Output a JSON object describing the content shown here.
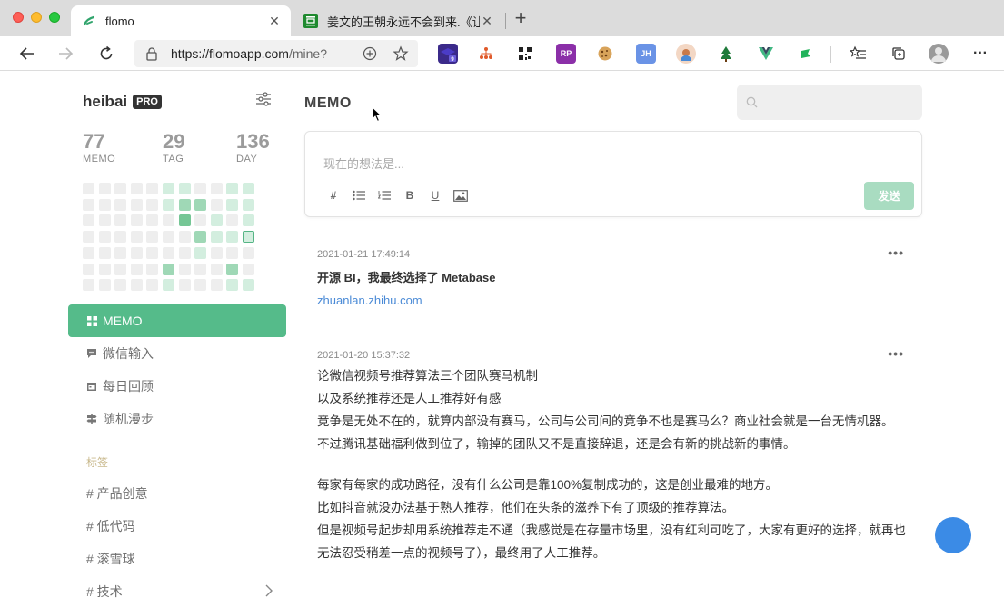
{
  "browser": {
    "tabs": [
      {
        "title": "flomo",
        "active": true,
        "icon": "flomo-icon"
      },
      {
        "title": "姜文的王朝永远不会到来.《让子",
        "active": false,
        "icon": "douban-icon"
      }
    ],
    "url_host": "https://flomoapp.com",
    "url_path": "/mine?",
    "extensions": [
      "graduation-cap-icon",
      "sitemap-icon",
      "qrcode-icon",
      "rp-icon",
      "cookie-icon",
      "jh-icon",
      "avatar-ext-icon",
      "tree-icon",
      "vue-icon",
      "flag-icon"
    ],
    "accent": "#55bb8a"
  },
  "sidebar": {
    "username": "heibai",
    "badge": "PRO",
    "stats": [
      {
        "value": "77",
        "label": "MEMO"
      },
      {
        "value": "29",
        "label": "TAG"
      },
      {
        "value": "136",
        "label": "DAY"
      }
    ],
    "heatmap": [
      [
        0,
        0,
        0,
        0,
        0,
        1,
        1,
        0,
        0,
        1,
        1
      ],
      [
        0,
        0,
        0,
        0,
        0,
        1,
        2,
        2,
        0,
        1,
        1
      ],
      [
        0,
        0,
        0,
        0,
        0,
        0,
        3,
        0,
        1,
        0,
        1
      ],
      [
        0,
        0,
        0,
        0,
        0,
        0,
        0,
        2,
        1,
        1,
        "t"
      ],
      [
        0,
        0,
        0,
        0,
        0,
        0,
        0,
        1,
        0,
        0,
        0
      ],
      [
        0,
        0,
        0,
        0,
        0,
        2,
        0,
        0,
        0,
        2,
        0
      ],
      [
        0,
        0,
        0,
        0,
        0,
        1,
        0,
        0,
        0,
        1,
        1
      ]
    ],
    "nav": [
      {
        "label": "MEMO",
        "active": true
      },
      {
        "label": "微信输入",
        "active": false
      },
      {
        "label": "每日回顾",
        "active": false
      },
      {
        "label": "随机漫步",
        "active": false
      }
    ],
    "tags_title": "标签",
    "tags": [
      "# 产品创意",
      "# 低代码",
      "# 滚雪球",
      "# 技术"
    ]
  },
  "main": {
    "title": "MEMO",
    "search_placeholder": "",
    "editor_placeholder": "现在的想法是...",
    "send_label": "发送",
    "memos": [
      {
        "time": "2021-01-21 17:49:14",
        "title": "开源 BI，我最终选择了 Metabase",
        "link": "zhuanlan.zhihu.com"
      },
      {
        "time": "2021-01-20 15:37:32",
        "paragraphs": [
          "论微信视频号推荐算法三个团队赛马机制",
          "以及系统推荐还是人工推荐好有感",
          "竞争是无处不在的，就算内部没有赛马，公司与公司间的竞争不也是赛马么？商业社会就是一台无情机器。",
          "不过腾讯基础福利做到位了，输掉的团队又不是直接辞退，还是会有新的挑战新的事情。",
          "",
          "每家有每家的成功路径，没有什么公司是靠100%复制成功的，这是创业最难的地方。",
          "比如抖音就没办法基于熟人推荐，他们在头条的滋养下有了顶级的推荐算法。",
          "但是视频号起步却用系统推荐走不通（我感觉是在存量市场里，没有红利可吃了，大家有更好的选择，就再也无法忍受稍差一点的视频号了），最终用了人工推荐。"
        ]
      }
    ]
  }
}
